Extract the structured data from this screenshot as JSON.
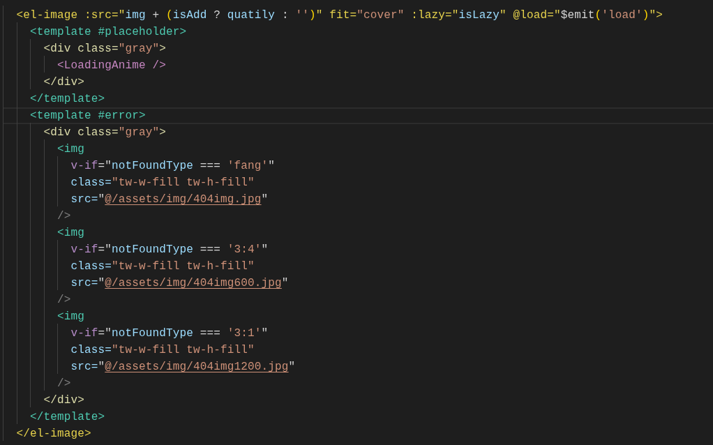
{
  "editor": {
    "lines": [
      {
        "current": false,
        "tokens": [
          {
            "text": "  <el-image :src=\"",
            "kind": "tag1"
          },
          {
            "text": "img",
            "kind": "ident"
          },
          {
            "text": " + ",
            "kind": "plain"
          },
          {
            "text": "(",
            "kind": "bracket"
          },
          {
            "text": "isAdd",
            "kind": "ident"
          },
          {
            "text": " ? ",
            "kind": "plain"
          },
          {
            "text": "quatily",
            "kind": "ident"
          },
          {
            "text": " : ",
            "kind": "plain"
          },
          {
            "text": "''",
            "kind": "string"
          },
          {
            "text": ")",
            "kind": "bracket"
          },
          {
            "text": "\" fit=",
            "kind": "tag1"
          },
          {
            "text": "\"cover\"",
            "kind": "string"
          },
          {
            "text": " :lazy=\"",
            "kind": "tag1"
          },
          {
            "text": "isLazy",
            "kind": "ident"
          },
          {
            "text": "\" @load=\"",
            "kind": "tag1"
          },
          {
            "text": "$emit",
            "kind": "plain"
          },
          {
            "text": "(",
            "kind": "bracket"
          },
          {
            "text": "'load'",
            "kind": "string"
          },
          {
            "text": ")",
            "kind": "bracket"
          },
          {
            "text": "\">",
            "kind": "tag1"
          }
        ]
      },
      {
        "current": false,
        "tokens": [
          {
            "text": "    <template #placeholder>",
            "kind": "tag2"
          }
        ]
      },
      {
        "current": false,
        "tokens": [
          {
            "text": "      <div class=",
            "kind": "tag3"
          },
          {
            "text": "\"gray\"",
            "kind": "string"
          },
          {
            "text": ">",
            "kind": "tag3"
          }
        ]
      },
      {
        "current": false,
        "tokens": [
          {
            "text": "        <LoadingAnime />",
            "kind": "tag4"
          }
        ]
      },
      {
        "current": false,
        "tokens": [
          {
            "text": "      </div>",
            "kind": "tag3"
          }
        ]
      },
      {
        "current": false,
        "tokens": [
          {
            "text": "    </template>",
            "kind": "tag2"
          }
        ]
      },
      {
        "current": true,
        "tokens": [
          {
            "text": "    <template #error>",
            "kind": "tag2"
          }
        ]
      },
      {
        "current": false,
        "tokens": [
          {
            "text": "      <div class=",
            "kind": "tag3"
          },
          {
            "text": "\"gray\"",
            "kind": "string"
          },
          {
            "text": ">",
            "kind": "tag3"
          }
        ]
      },
      {
        "current": false,
        "tokens": [
          {
            "text": "        <img",
            "kind": "tag2"
          }
        ]
      },
      {
        "current": false,
        "tokens": [
          {
            "text": "          v-if",
            "kind": "directive"
          },
          {
            "text": "=\"",
            "kind": "plain"
          },
          {
            "text": "notFoundType",
            "kind": "ident"
          },
          {
            "text": " === ",
            "kind": "plain"
          },
          {
            "text": "'fang'",
            "kind": "string"
          },
          {
            "text": "\"",
            "kind": "plain"
          }
        ]
      },
      {
        "current": false,
        "tokens": [
          {
            "text": "          class=",
            "kind": "attr"
          },
          {
            "text": "\"tw-w-fill tw-h-fill\"",
            "kind": "string"
          }
        ]
      },
      {
        "current": false,
        "tokens": [
          {
            "text": "          src=",
            "kind": "attr"
          },
          {
            "text": "\"",
            "kind": "plain"
          },
          {
            "text": "@/assets/img/404img.jpg",
            "kind": "link"
          },
          {
            "text": "\"",
            "kind": "plain"
          }
        ]
      },
      {
        "current": false,
        "tokens": [
          {
            "text": "        />",
            "kind": "punct"
          }
        ]
      },
      {
        "current": false,
        "tokens": [
          {
            "text": "        <img",
            "kind": "tag2"
          }
        ]
      },
      {
        "current": false,
        "tokens": [
          {
            "text": "          v-if",
            "kind": "directive"
          },
          {
            "text": "=\"",
            "kind": "plain"
          },
          {
            "text": "notFoundType",
            "kind": "ident"
          },
          {
            "text": " === ",
            "kind": "plain"
          },
          {
            "text": "'3:4'",
            "kind": "string"
          },
          {
            "text": "\"",
            "kind": "plain"
          }
        ]
      },
      {
        "current": false,
        "tokens": [
          {
            "text": "          class=",
            "kind": "attr"
          },
          {
            "text": "\"tw-w-fill tw-h-fill\"",
            "kind": "string"
          }
        ]
      },
      {
        "current": false,
        "tokens": [
          {
            "text": "          src=",
            "kind": "attr"
          },
          {
            "text": "\"",
            "kind": "plain"
          },
          {
            "text": "@/assets/img/404img600.jpg",
            "kind": "link"
          },
          {
            "text": "\"",
            "kind": "plain"
          }
        ]
      },
      {
        "current": false,
        "tokens": [
          {
            "text": "        />",
            "kind": "punct"
          }
        ]
      },
      {
        "current": false,
        "tokens": [
          {
            "text": "        <img",
            "kind": "tag2"
          }
        ]
      },
      {
        "current": false,
        "tokens": [
          {
            "text": "          v-if",
            "kind": "directive"
          },
          {
            "text": "=\"",
            "kind": "plain"
          },
          {
            "text": "notFoundType",
            "kind": "ident"
          },
          {
            "text": " === ",
            "kind": "plain"
          },
          {
            "text": "'3:1'",
            "kind": "string"
          },
          {
            "text": "\"",
            "kind": "plain"
          }
        ]
      },
      {
        "current": false,
        "tokens": [
          {
            "text": "          class=",
            "kind": "attr"
          },
          {
            "text": "\"tw-w-fill tw-h-fill\"",
            "kind": "string"
          }
        ]
      },
      {
        "current": false,
        "tokens": [
          {
            "text": "          src=",
            "kind": "attr"
          },
          {
            "text": "\"",
            "kind": "plain"
          },
          {
            "text": "@/assets/img/404img1200.jpg",
            "kind": "link"
          },
          {
            "text": "\"",
            "kind": "plain"
          }
        ]
      },
      {
        "current": false,
        "tokens": [
          {
            "text": "        />",
            "kind": "punct"
          }
        ]
      },
      {
        "current": false,
        "tokens": [
          {
            "text": "      </div>",
            "kind": "tag3"
          }
        ]
      },
      {
        "current": false,
        "tokens": [
          {
            "text": "    </template>",
            "kind": "tag2"
          }
        ]
      },
      {
        "current": false,
        "tokens": [
          {
            "text": "  </el-image>",
            "kind": "tag1"
          }
        ]
      }
    ]
  }
}
